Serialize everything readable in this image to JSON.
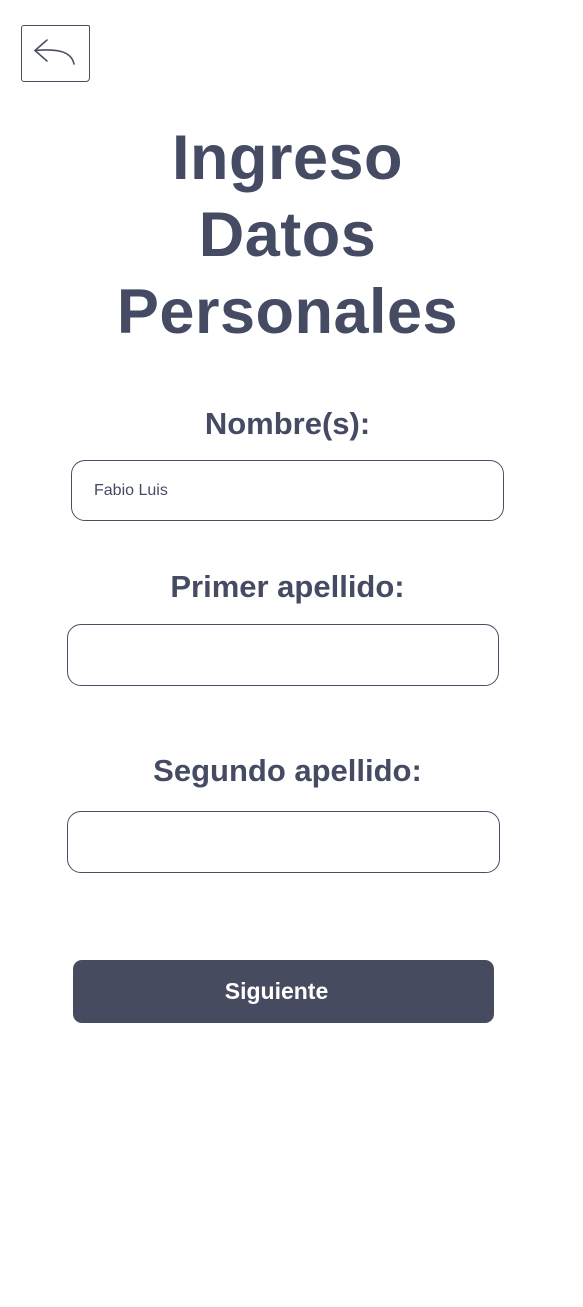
{
  "header": {
    "back_icon": "reply-arrow-icon",
    "title_lines": [
      "Ingreso",
      "Datos",
      "Personales"
    ]
  },
  "form": {
    "nombre": {
      "label": "Nombre(s):",
      "value": "Fabio Luis",
      "placeholder": ""
    },
    "primer_apellido": {
      "label": "Primer apellido:",
      "value": "",
      "placeholder": ""
    },
    "segundo_apellido": {
      "label": "Segundo apellido:",
      "value": "",
      "placeholder": ""
    },
    "next_label": "Siguiente"
  },
  "colors": {
    "text": "#444b63",
    "button_bg": "#474b60",
    "border": "#4a5064"
  }
}
